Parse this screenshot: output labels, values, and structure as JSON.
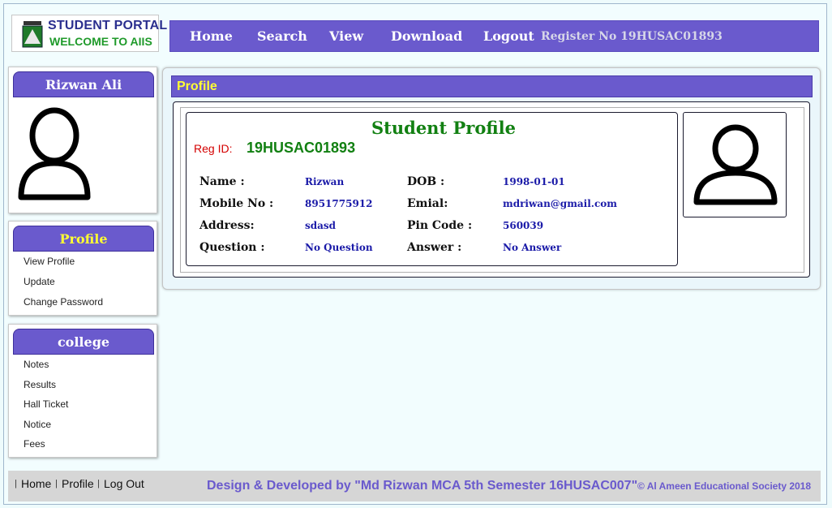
{
  "logo": {
    "title": "STUDENT PORTAL",
    "subtitle": "WELCOME TO AIIS"
  },
  "nav": {
    "items": [
      "Home",
      "Search",
      "View",
      "Download",
      "Logout"
    ],
    "register_text": "Register No 19HUSAC01893"
  },
  "user_panel": {
    "name": "Rizwan Ali",
    "avatar_icon": "user-avatar-icon"
  },
  "profile_menu": {
    "title": "Profile",
    "links": [
      "View Profile",
      "Update",
      "Change Password"
    ]
  },
  "college_menu": {
    "title": "college",
    "links": [
      "Notes",
      "Results",
      "Hall Ticket",
      "Notice",
      "Fees"
    ]
  },
  "main": {
    "section_title": "Profile",
    "card_title": "Student Profile",
    "reg_label": "Reg ID:",
    "reg_value": "19HUSAC01893",
    "fields": {
      "name": {
        "label": "Name :",
        "value": "Rizwan"
      },
      "dob": {
        "label": "DOB :",
        "value": "1998-01-01"
      },
      "mobile": {
        "label": "Mobile No :",
        "value": "8951775912"
      },
      "email": {
        "label": "Emial:",
        "value": "mdriwan@gmail.com"
      },
      "address": {
        "label": "Address:",
        "value": "sdasd"
      },
      "pincode": {
        "label": "Pin Code :",
        "value": "560039"
      },
      "question": {
        "label": "Question :",
        "value": "No Question"
      },
      "answer": {
        "label": "Answer :",
        "value": "No Answer"
      }
    }
  },
  "footer": {
    "links": [
      "Home",
      "Profile",
      "Log Out"
    ],
    "credit": "Design & Developed by \"Md Rizwan MCA 5th Semester 16HUSAC007\"",
    "copyright": "© Al Ameen Educational Society 2018"
  },
  "colors": {
    "accent": "#6a5acd",
    "heading_yellow": "#ffff33",
    "title_green": "#128012",
    "reg_red": "#d40000",
    "value_blue": "#1a1aa8"
  }
}
